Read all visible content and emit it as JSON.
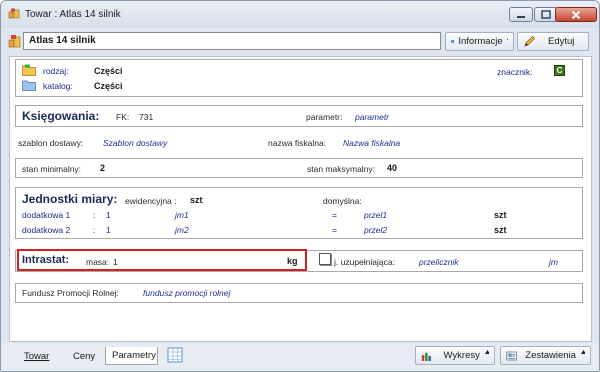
{
  "window": {
    "title": "Towar : Atlas 14 silnik"
  },
  "header": {
    "name": "Atlas 14 silnik",
    "info_label": "Informacje",
    "edit_label": "Edytuj"
  },
  "general": {
    "rodzaj_label": "rodzaj:",
    "rodzaj_value": "Części",
    "katalog_label": "katalog:",
    "katalog_value": "Części",
    "znacznik_label": "znacznik:",
    "znacznik_value": "C"
  },
  "ksiegowania": {
    "title": "Księgowania:",
    "fk_label": "FK:",
    "fk_value": "731",
    "parametr_label": "parametr:",
    "parametr_value": "parametr"
  },
  "szablon": {
    "label": "szablon dostawy:",
    "value": "Szablon dostawy",
    "nazwa_label": "nazwa fiskalna:",
    "nazwa_value": "Nazwa fiskalna"
  },
  "stany": {
    "min_label": "stan minimalny:",
    "min_value": "2",
    "max_label": "stan maksymalny:",
    "max_value": "40"
  },
  "jednostki": {
    "title": "Jednostki miary:",
    "ewid_label": "ewidencyjna :",
    "ewid_value": "szt",
    "domyslna_label": "domyślna:",
    "rows": [
      {
        "label": "dodatkowa 1",
        "colon": ":",
        "qty": "1",
        "unit": "jm1",
        "eq": "=",
        "conv": "przel1",
        "base": "szt"
      },
      {
        "label": "dodatkowa 2",
        "colon": ":",
        "qty": "1",
        "unit": "jm2",
        "eq": "=",
        "conv": "przel2",
        "base": "szt"
      }
    ]
  },
  "intrastat": {
    "title": "Intrastat:",
    "masa_label": "masa:",
    "masa_value": "1",
    "masa_unit": "kg",
    "jm_label": "j. uzupełniająca:",
    "przelicznik": "przelicznik",
    "jm_value": "jm"
  },
  "fundusz": {
    "label": "Fundusz Promocji Rolnej:",
    "value": "fundusz promocji rolnej"
  },
  "tabs": [
    {
      "label": "Towar"
    },
    {
      "label": "Ceny"
    },
    {
      "label": "Parametry"
    }
  ],
  "bottom": {
    "wykresy": "Wykresy",
    "zestawienia": "Zestawienia"
  },
  "colors": {
    "accent_red": "#d42020",
    "title_blue": "#1c2a5a",
    "italic_blue": "#1f2f9a",
    "znacznik_green": "#3d7a1e"
  }
}
